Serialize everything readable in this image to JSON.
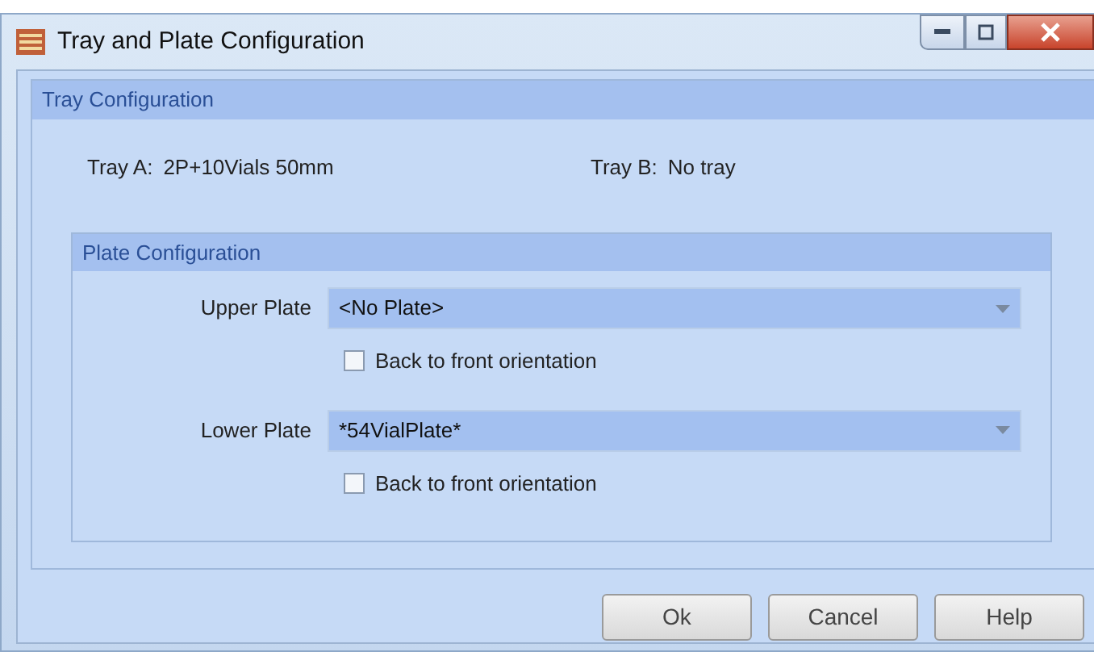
{
  "window": {
    "title": "Tray and Plate Configuration"
  },
  "tray_configuration": {
    "title": "Tray Configuration",
    "trays": [
      {
        "label": "Tray A:",
        "value": "2P+10Vials 50mm"
      },
      {
        "label": "Tray B:",
        "value": "No tray"
      }
    ]
  },
  "plate_configuration": {
    "title": "Plate Configuration",
    "plates": [
      {
        "label": "Upper Plate",
        "value": "<No Plate>",
        "orientation_label": "Back to front orientation",
        "checked": false
      },
      {
        "label": "Lower Plate",
        "value": "*54VialPlate*",
        "orientation_label": "Back to front orientation",
        "checked": false
      }
    ]
  },
  "buttons": [
    "Ok",
    "Cancel",
    "Help"
  ]
}
